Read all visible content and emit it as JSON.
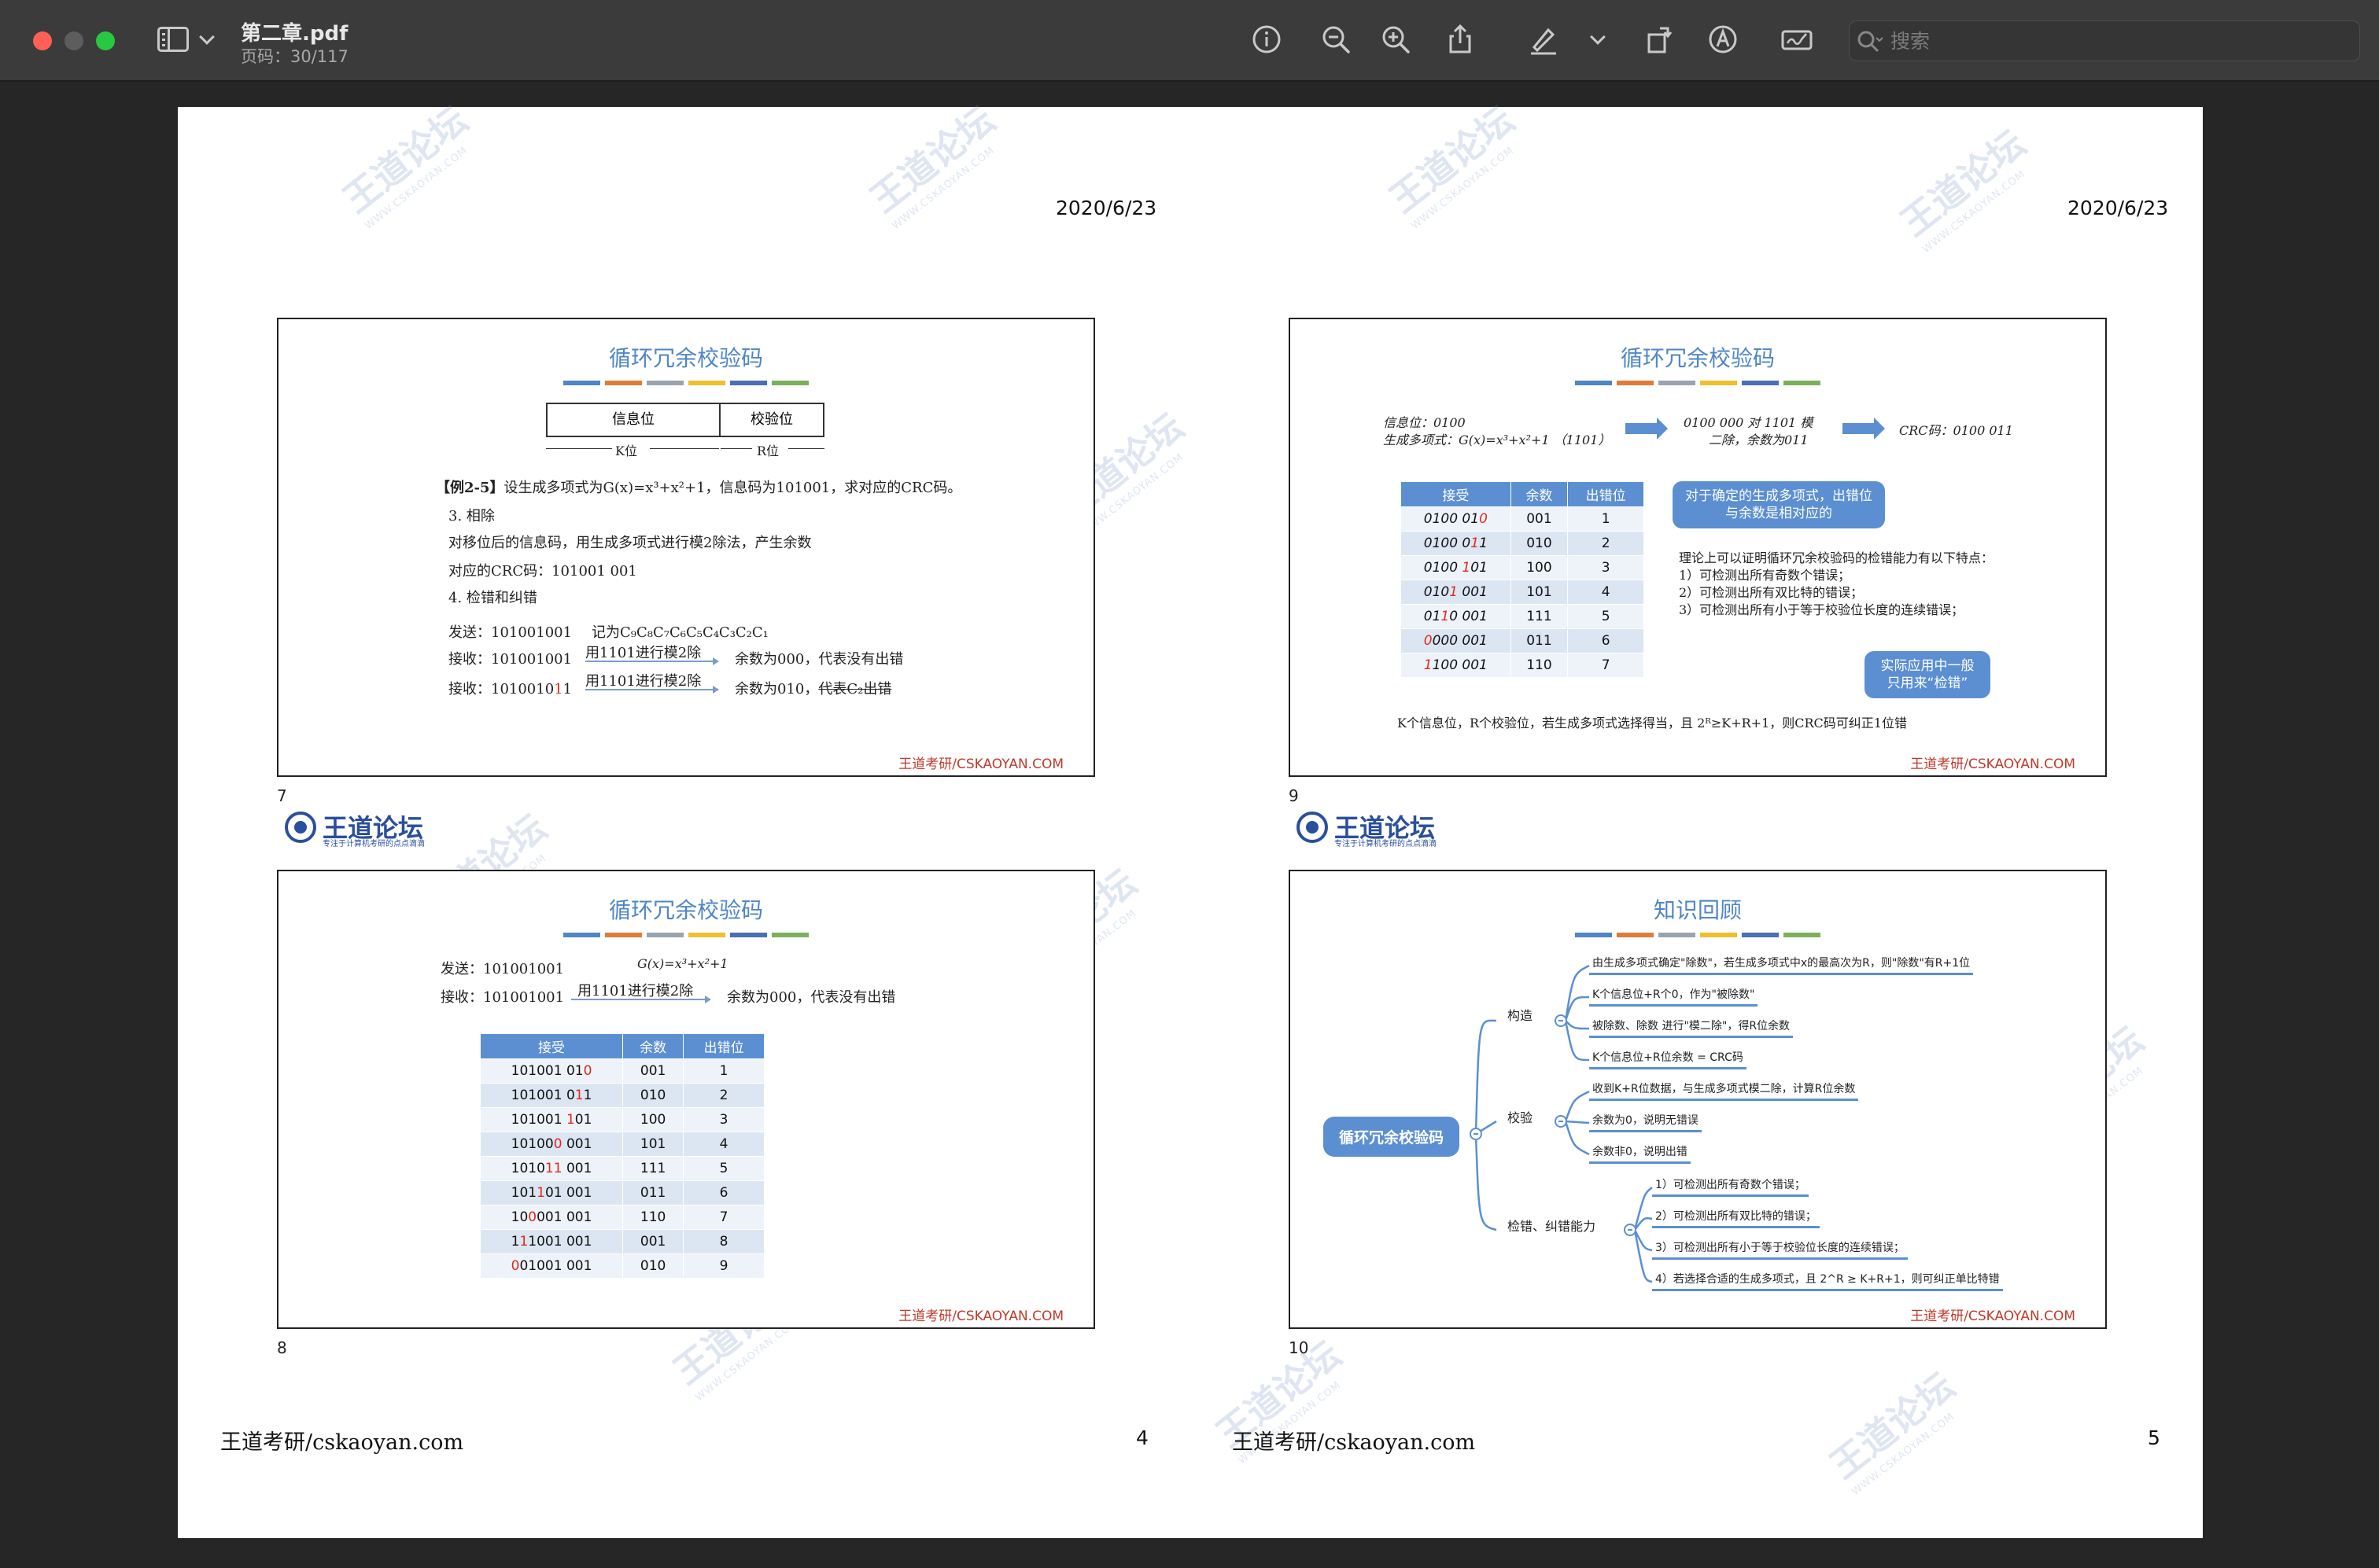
{
  "window": {
    "title": "第二章.pdf",
    "page_indicator": "页码：30/117",
    "search_placeholder": "搜索"
  },
  "toolbar_icons": [
    "info-icon",
    "zoom-out-icon",
    "zoom-in-icon",
    "share-icon",
    "highlight-pen-icon",
    "chevron-down-icon",
    "rotate-icon",
    "markup-icon",
    "signature-icon"
  ],
  "page": {
    "date_left": "2020/6/23",
    "date_right": "2020/6/23",
    "footer_left_1": "王道考研/cskaoyan.com",
    "footer_left_2": "王道考研/cskaoyan.com",
    "page_num_left": "4",
    "page_num_right": "5",
    "watermark": "王道论坛",
    "watermark_sub": "WWW.CSKAOYAN.COM"
  },
  "logo": {
    "name": "王道论坛",
    "tag": "专注于计算机考研的点点滴滴"
  },
  "colors": {
    "accent": "#5b8fd2",
    "credit": "#c0392b",
    "bar_colors": [
      "#4f86c6",
      "#e07b39",
      "#9aa4ae",
      "#f0bf2c",
      "#4a6fb5",
      "#7bb05a"
    ]
  },
  "slide7": {
    "number": "7",
    "title": "循环冗余校验码",
    "frame_info": "信息位",
    "frame_check": "校验位",
    "frame_k": "K位",
    "frame_r": "R位",
    "example_tag": "【例2-5】",
    "example_text": "设生成多项式为G(x)=x³+x²+1，信息码为101001，求对应的CRC码。",
    "step3": "3. 相除",
    "step3_text": "对移位后的信息码，用生成多项式进行模2除法，产生余数",
    "crc_line": "对应的CRC码：101001 001",
    "step4": "4. 检错和纠错",
    "send": "发送：101001001",
    "send_note": "记为C₉C₈C₇C₆C₅C₄C₃C₂C₁",
    "recv1": "接收：101001001",
    "recv1_op": "用1101进行模2除",
    "recv1_result": "余数为000，代表没有出错",
    "recv2_prefix": "接收：1010010",
    "recv2_red": "1",
    "recv2_suffix": "1",
    "recv2_op": "用1101进行模2除",
    "recv2_result": "余数为010，",
    "recv2_strike": "代表C₂出错",
    "credit": "王道考研/CSKAOYAN.COM"
  },
  "slide8": {
    "number": "8",
    "title": "循环冗余校验码",
    "send": "发送：101001001",
    "poly": "G(x)=x³+x²+1",
    "recv": "接收：101001001",
    "op": "用1101进行模2除",
    "result": "余数为000，代表没有出错",
    "headers": [
      "接受",
      "余数",
      "出错位"
    ],
    "rows": [
      {
        "a": "101001 01",
        "r": "0",
        "b": "",
        "rem": "001",
        "pos": "1"
      },
      {
        "a": "101001 0",
        "r": "1",
        "b": "1",
        "rem": "010",
        "pos": "2"
      },
      {
        "a": "101001 ",
        "r": "1",
        "b": "01",
        "rem": "100",
        "pos": "3"
      },
      {
        "a": "10100",
        "r": "0",
        "b": " 001",
        "rem": "101",
        "pos": "4"
      },
      {
        "a": "1010",
        "r": "11",
        "b": " 001",
        "rem": "111",
        "pos": "5"
      },
      {
        "a": "101",
        "r": "1",
        "b": "01 001",
        "rem": "011",
        "pos": "6"
      },
      {
        "a": "10",
        "r": "0",
        "b": "001 001",
        "rem": "110",
        "pos": "7"
      },
      {
        "a": "1",
        "r": "1",
        "b": "1001 001",
        "rem": "001",
        "pos": "8"
      },
      {
        "a": "",
        "r": "0",
        "b": "01001 001",
        "rem": "010",
        "pos": "9"
      }
    ],
    "credit": "王道考研/CSKAOYAN.COM"
  },
  "slide9": {
    "number": "9",
    "title": "循环冗余校验码",
    "info": "信息位：0100",
    "poly": "生成多项式：G(x)=x³+x²+1 （1101）",
    "div1": "0100 000 对 1101 模",
    "div2": "二除，余数为011",
    "crc": "CRC码：0100 011",
    "headers": [
      "接受",
      "余数",
      "出错位"
    ],
    "rows": [
      {
        "a": "0100 01",
        "r": "0",
        "b": "",
        "rem": "001",
        "pos": "1"
      },
      {
        "a": "0100 0",
        "r": "1",
        "b": "1",
        "rem": "010",
        "pos": "2"
      },
      {
        "a": "0100 ",
        "r": "1",
        "b": "01",
        "rem": "100",
        "pos": "3"
      },
      {
        "a": "010",
        "r": "1",
        "b": " 001",
        "rem": "101",
        "pos": "4"
      },
      {
        "a": "01",
        "r": "1",
        "b": "0 001",
        "rem": "111",
        "pos": "5"
      },
      {
        "a": "",
        "r": "0",
        "b": "000 001",
        "rem": "011",
        "pos": "6"
      },
      {
        "a": "",
        "r": "1",
        "b": "100 001",
        "rem": "110",
        "pos": "7"
      }
    ],
    "callout1": "对于确定的生成多项式，出错位与余数是相对应的",
    "theory": "理论上可以证明循环冗余校验码的检错能力有以下特点：",
    "t1": "1）可检测出所有奇数个错误；",
    "t2": "2）可检测出所有双比特的错误；",
    "t3": "3）可检测出所有小于等于校验位长度的连续错误；",
    "callout2": "实际应用中一般只用来“检错”",
    "bottom": "K个信息位，R个校验位，若生成多项式选择得当，且 2ᴿ≥K+R+1，则CRC码可纠正1位错",
    "credit": "王道考研/CSKAOYAN.COM"
  },
  "slide10": {
    "number": "10",
    "title": "知识回顾",
    "root": "循环冗余校验码",
    "branch1": "构造",
    "b1_leaves": [
      "由生成多项式确定\"除数\"，若生成多项式中x的最高次为R，则\"除数\"有R+1位",
      "K个信息位+R个0，作为\"被除数\"",
      "被除数、除数 进行\"模二除\"，得R位余数",
      "K个信息位+R位余数 = CRC码"
    ],
    "branch2": "校验",
    "b2_leaves": [
      "收到K+R位数据，与生成多项式模二除，计算R位余数",
      "余数为0，说明无错误",
      "余数非0，说明出错"
    ],
    "branch3": "检错、纠错能力",
    "b3_leaves": [
      "1）可检测出所有奇数个错误；",
      "2）可检测出所有双比特的错误；",
      "3）可检测出所有小于等于校验位长度的连续错误；",
      "4）若选择合适的生成多项式，且 2^R ≥ K+R+1，则可纠正单比特错"
    ],
    "credit": "王道考研/CSKAOYAN.COM"
  }
}
